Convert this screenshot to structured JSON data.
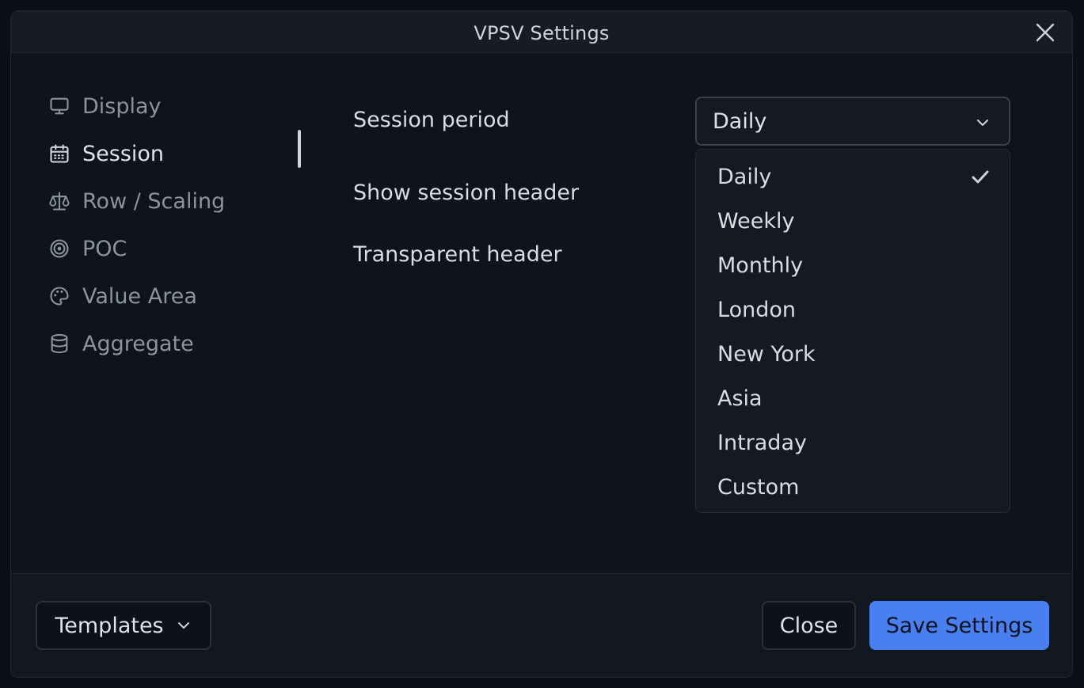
{
  "dialog": {
    "title": "VPSV Settings"
  },
  "sidebar": {
    "items": [
      {
        "label": "Display",
        "icon": "monitor-icon",
        "active": false
      },
      {
        "label": "Session",
        "icon": "calendar-icon",
        "active": true
      },
      {
        "label": "Row / Scaling",
        "icon": "scale-icon",
        "active": false
      },
      {
        "label": "POC",
        "icon": "target-icon",
        "active": false
      },
      {
        "label": "Value Area",
        "icon": "palette-icon",
        "active": false
      },
      {
        "label": "Aggregate",
        "icon": "database-icon",
        "active": false
      }
    ]
  },
  "session": {
    "period_label": "Session period",
    "period_value": "Daily",
    "show_header_label": "Show session header",
    "transparent_header_label": "Transparent header",
    "options": [
      "Daily",
      "Weekly",
      "Monthly",
      "London",
      "New York",
      "Asia",
      "Intraday",
      "Custom"
    ],
    "selected_option": "Daily"
  },
  "footer": {
    "templates_label": "Templates",
    "close_label": "Close",
    "save_label": "Save Settings"
  },
  "colors": {
    "accent": "#4a7ff0",
    "background": "#0f131b"
  }
}
